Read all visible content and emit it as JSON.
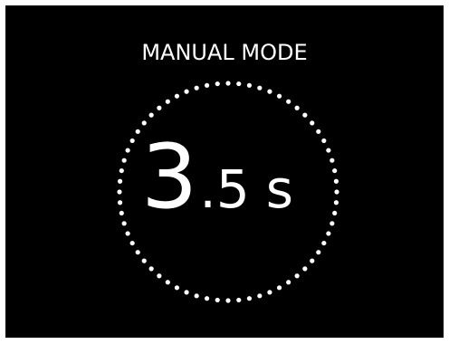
{
  "header": {
    "mode_label": "MANUAL MODE"
  },
  "readout": {
    "integer": "3",
    "decimal": ".5",
    "unit": "s"
  },
  "colors": {
    "background": "#000000",
    "foreground": "#ffffff",
    "frame": "#ffffff"
  },
  "icons": {
    "ring": "dotted-circle-icon"
  }
}
